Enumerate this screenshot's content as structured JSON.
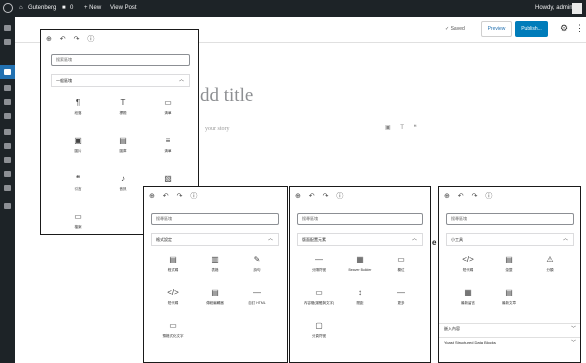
{
  "admin_bar": {
    "site_name": "Gutenberg",
    "comments_count": "0",
    "new_label": "+ New",
    "view_post": "View Post",
    "howdy": "Howdy, admin"
  },
  "editor": {
    "saved_label": "✓ Saved",
    "preview_label": "Preview",
    "publish_label": "Publish...",
    "title_placeholder": "dd title",
    "body_placeholder": "your story",
    "accent_color": "#007cba"
  },
  "panel_main": {
    "search_placeholder": "搜索區塊",
    "category": "一般區塊",
    "blocks": [
      {
        "icon": "¶",
        "label": "段落"
      },
      {
        "icon": "T",
        "label": "標題"
      },
      {
        "icon": "▭",
        "label": "清單"
      },
      {
        "icon": "▣",
        "label": "圖片"
      },
      {
        "icon": "▤",
        "label": "圖庫"
      },
      {
        "icon": "≡",
        "label": "清單"
      },
      {
        "icon": "❝",
        "label": "引言"
      },
      {
        "icon": "♪",
        "label": "音訊"
      },
      {
        "icon": "▧",
        "label": "封面"
      },
      {
        "icon": "▭",
        "label": "檔案"
      }
    ]
  },
  "panel_format": {
    "search_placeholder": "搜尋區塊",
    "category": "格式設定",
    "blocks": [
      {
        "icon": "▤",
        "label": "程式碼"
      },
      {
        "icon": "▥",
        "label": "表格"
      },
      {
        "icon": "✎",
        "label": "詩句"
      },
      {
        "icon": "</>",
        "label": "短代碼"
      },
      {
        "icon": "▤",
        "label": "傳統編輯器"
      },
      {
        "icon": "—",
        "label": "自訂 HTML"
      },
      {
        "icon": "▭",
        "label": "預格式化文字"
      }
    ]
  },
  "panel_layout": {
    "search_placeholder": "搜尋區塊",
    "category": "版面配置元素",
    "blocks": [
      {
        "icon": "—",
        "label": "分隔符號"
      },
      {
        "icon": "▦",
        "label": "Beaver Builder"
      },
      {
        "icon": "▭",
        "label": "欄位"
      },
      {
        "icon": "▭",
        "label": "內容權(媒體與文字)"
      },
      {
        "icon": "↕",
        "label": "間距"
      },
      {
        "icon": "—",
        "label": "更多"
      },
      {
        "icon": "▢",
        "label": "分頁符號"
      }
    ]
  },
  "panel_widgets": {
    "search_placeholder": "搜尋區塊",
    "category": "小工具",
    "blocks": [
      {
        "icon": "</>",
        "label": "短代碼"
      },
      {
        "icon": "▤",
        "label": "彙整"
      },
      {
        "icon": "⚠",
        "label": "分類"
      },
      {
        "icon": "▦",
        "label": "最新留言"
      },
      {
        "icon": "▤",
        "label": "最新文章"
      }
    ],
    "row_embeds": "嵌入內容",
    "row_yoast": "Yoast Structured Data Blocks"
  }
}
